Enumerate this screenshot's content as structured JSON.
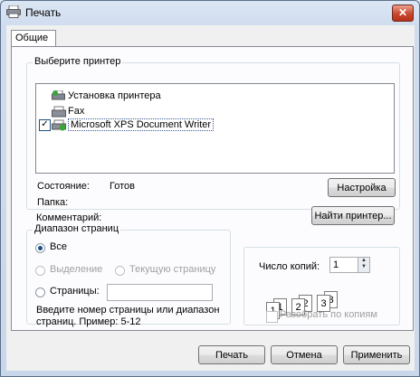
{
  "window": {
    "title": "Печать",
    "close_glyph": "✕"
  },
  "tab_label": "Общие",
  "printer_group": {
    "title": "Выберите принтер",
    "printers": [
      {
        "label": "Установка принтера",
        "icon": "add-printer-icon"
      },
      {
        "label": "Fax",
        "icon": "fax-icon"
      },
      {
        "label": "Microsoft XPS Document Writer",
        "icon": "xps-printer-icon",
        "selected": true
      }
    ],
    "status_label": "Состояние:",
    "status_value": "Готов",
    "folder_label": "Папка:",
    "comment_label": "Комментарий:",
    "settings_button": "Настройка",
    "find_printer_button": "Найти принтер..."
  },
  "range_group": {
    "title": "Диапазон страниц",
    "all": "Все",
    "selection": "Выделение",
    "current_page": "Текущую страницу",
    "pages": "Страницы:",
    "pages_value": "",
    "hint": "Введите номер страницы или диапазон страниц.  Пример: 5-12"
  },
  "copies_group": {
    "copies_label": "Число копий:",
    "copies_value": "1",
    "collate_label": "Разобрать по копиям",
    "collate_checked": false
  },
  "buttons": {
    "print": "Печать",
    "cancel": "Отмена",
    "apply": "Применить"
  }
}
